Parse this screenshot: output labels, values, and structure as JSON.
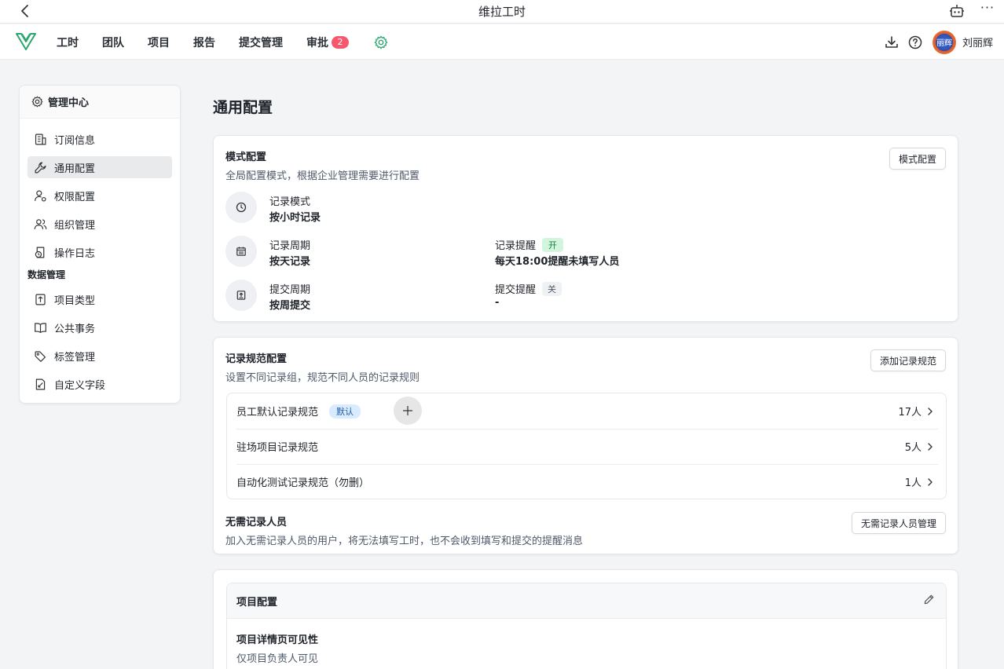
{
  "window": {
    "title": "维拉工时"
  },
  "nav": {
    "items": [
      {
        "label": "工时"
      },
      {
        "label": "团队"
      },
      {
        "label": "项目"
      },
      {
        "label": "报告"
      },
      {
        "label": "提交管理"
      },
      {
        "label": "审批",
        "badge": "2"
      }
    ],
    "settings_icon": "gear-icon",
    "download_icon": "download-icon",
    "help_icon": "help-icon",
    "avatar_text": "丽辉",
    "user_name": "刘丽辉"
  },
  "sidebar": {
    "header": "管理中心",
    "items": [
      {
        "label": "订阅信息",
        "icon": "building-icon",
        "active": false
      },
      {
        "label": "通用配置",
        "icon": "wrench-icon",
        "active": true
      },
      {
        "label": "权限配置",
        "icon": "user-lock-icon",
        "active": false
      },
      {
        "label": "组织管理",
        "icon": "users-icon",
        "active": false
      },
      {
        "label": "操作日志",
        "icon": "log-icon",
        "active": false
      }
    ],
    "group_label": "数据管理",
    "group_items": [
      {
        "label": "项目类型",
        "icon": "project-type-icon"
      },
      {
        "label": "公共事务",
        "icon": "book-icon"
      },
      {
        "label": "标签管理",
        "icon": "tag-icon"
      },
      {
        "label": "自定义字段",
        "icon": "custom-field-icon"
      }
    ]
  },
  "page": {
    "title": "通用配置"
  },
  "mode_config": {
    "title": "模式配置",
    "subtitle": "全局配置模式，根据企业管理需要进行配置",
    "button": "模式配置",
    "record_mode_label": "记录模式",
    "record_mode_value": "按小时记录",
    "record_period_label": "记录周期",
    "record_period_value": "按天记录",
    "record_reminder_label": "记录提醒",
    "record_reminder_state": "开",
    "record_reminder_value": "每天18:00提醒未填写人员",
    "submit_period_label": "提交周期",
    "submit_period_value": "按周提交",
    "submit_reminder_label": "提交提醒",
    "submit_reminder_state": "关",
    "submit_reminder_value": "-"
  },
  "rule_config": {
    "title": "记录规范配置",
    "subtitle": "设置不同记录组，规范不同人员的记录规则",
    "button": "添加记录规范",
    "rules": [
      {
        "name": "员工默认记录规范",
        "tag": "默认",
        "count": "17人"
      },
      {
        "name": "驻场项目记录规范",
        "count": "5人"
      },
      {
        "name": "自动化测试记录规范（勿删）",
        "count": "1人"
      }
    ],
    "exempt_title": "无需记录人员",
    "exempt_subtitle": "加入无需记录人员的用户，将无法填写工时，也不会收到填写和提交的提醒消息",
    "exempt_button": "无需记录人员管理"
  },
  "project_config": {
    "title": "项目配置",
    "visibility_title": "项目详情页可见性",
    "visibility_value": "仅项目负责人可见"
  }
}
